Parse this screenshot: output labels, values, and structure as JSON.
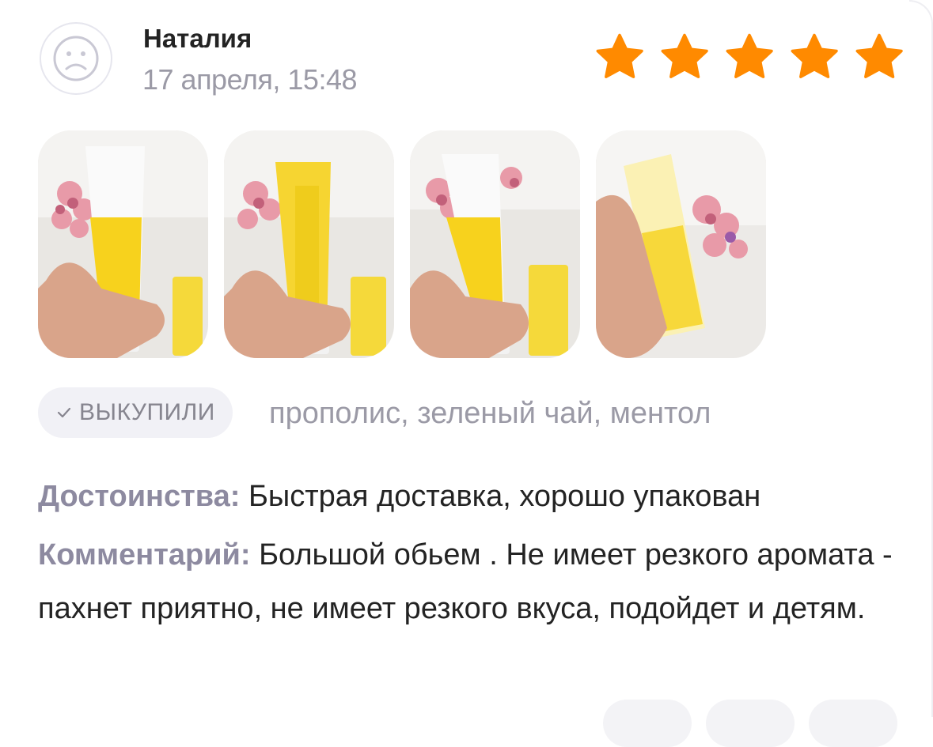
{
  "review": {
    "author": "Наталия",
    "date": "17 апреля, 15:48",
    "rating": 5,
    "rating_max": 5,
    "star_color": "#ff8a00",
    "purchased_badge": "ВЫКУПИЛИ",
    "variant": "прополис, зеленый чай, ментол",
    "pros_label": "Достоинства:",
    "pros_text": "Быстрая доставка, хорошо упакован",
    "comment_label": "Комментарий:",
    "comment_text": "Большой обьем . Не имеет резкого аромата - пахнет приятно, не имеет резкого вкуса, подойдет и детям.",
    "photos": [
      {
        "icon": "toothpaste-tube-front-photo"
      },
      {
        "icon": "toothpaste-tube-back-photo"
      },
      {
        "icon": "toothpaste-tube-front-photo"
      },
      {
        "icon": "toothpaste-tube-side-photo"
      }
    ]
  }
}
